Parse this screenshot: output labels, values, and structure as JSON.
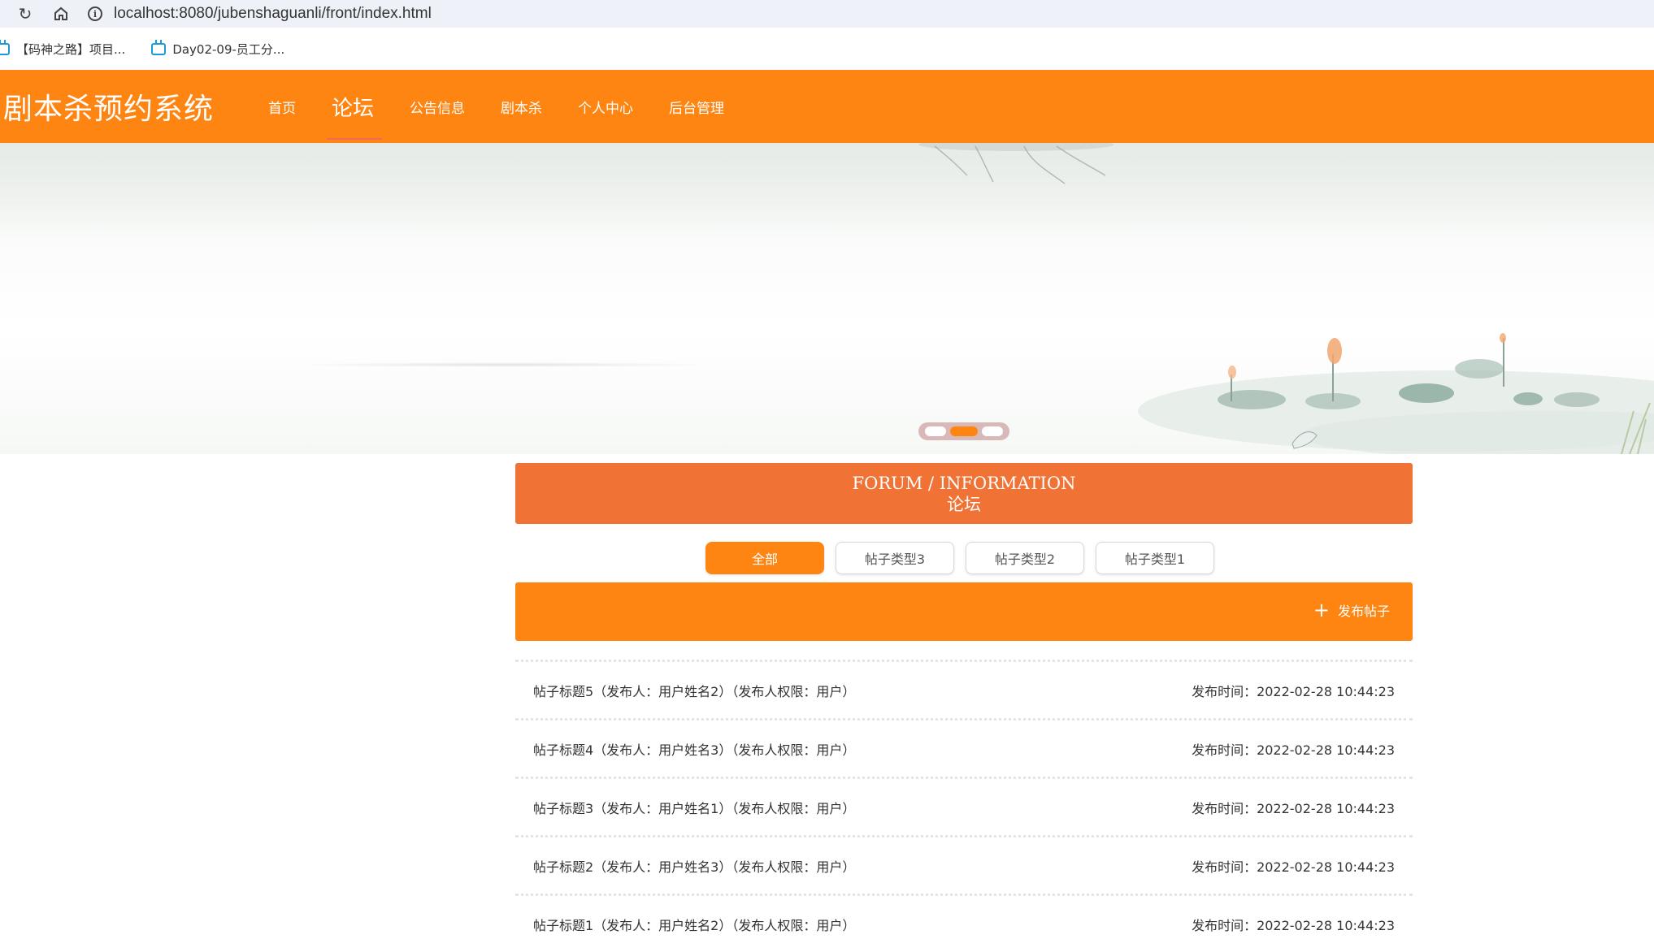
{
  "browser": {
    "url": "localhost:8080/jubenshaguanli/front/index.html",
    "bookmarks": [
      {
        "label": "【码神之路】项目..."
      },
      {
        "label": "Day02-09-员工分..."
      }
    ]
  },
  "header": {
    "site_title": "剧本杀预约系统",
    "nav": [
      {
        "label": "首页"
      },
      {
        "label": "论坛"
      },
      {
        "label": "公告信息"
      },
      {
        "label": "剧本杀"
      },
      {
        "label": "个人中心"
      },
      {
        "label": "后台管理"
      }
    ],
    "active_nav": "论坛",
    "accent_color": "#fe8512"
  },
  "carousel": {
    "slide_count": 3,
    "active_index": 1
  },
  "forum": {
    "title_en": "FORUM / INFORMATION",
    "title_cn": "论坛",
    "filters": [
      {
        "label": "全部"
      },
      {
        "label": "帖子类型3"
      },
      {
        "label": "帖子类型2"
      },
      {
        "label": "帖子类型1"
      }
    ],
    "active_filter": "全部",
    "publish_label": "发布帖子",
    "posts": [
      {
        "title": "帖子标题5（发布人：用户姓名2）（发布人权限：用户）",
        "time": "发布时间：2022-02-28 10:44:23"
      },
      {
        "title": "帖子标题4（发布人：用户姓名3）（发布人权限：用户）",
        "time": "发布时间：2022-02-28 10:44:23"
      },
      {
        "title": "帖子标题3（发布人：用户姓名1）（发布人权限：用户）",
        "time": "发布时间：2022-02-28 10:44:23"
      },
      {
        "title": "帖子标题2（发布人：用户姓名3）（发布人权限：用户）",
        "time": "发布时间：2022-02-28 10:44:23"
      },
      {
        "title": "帖子标题1（发布人：用户姓名2）（发布人权限：用户）",
        "time": "发布时间：2022-02-28 10:44:23"
      }
    ]
  }
}
